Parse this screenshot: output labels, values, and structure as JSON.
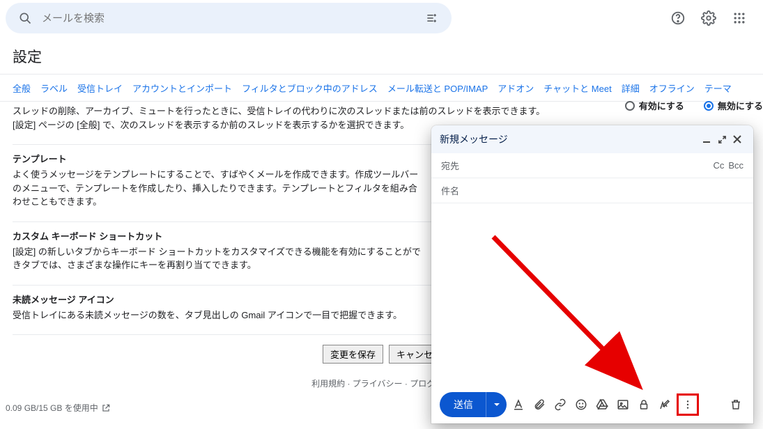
{
  "search": {
    "placeholder": "メールを検索"
  },
  "settings_title": "設定",
  "tabs": [
    "全般",
    "ラベル",
    "受信トレイ",
    "アカウントとインポート",
    "フィルタとブロック中のアドレス",
    "メール転送と POP/IMAP",
    "アドオン",
    "チャットと Meet",
    "詳細",
    "オフライン",
    "テーマ"
  ],
  "active_tab_index": 8,
  "radio": {
    "enable": "有効にする",
    "disable": "無効にする",
    "selected": "disable"
  },
  "sections": {
    "autoadvance_desc": "スレッドの削除、アーカイブ、ミュートを行ったときに、受信トレイの代わりに次のスレッドまたは前のスレッドを表示できます。[設定] ページの [全般] で、次のスレッドを表示するか前のスレッドを表示するかを選択できます。",
    "templates_title": "テンプレート",
    "templates_desc": "よく使うメッセージをテンプレートにすることで、すばやくメールを作成できます。作成ツールバーのメニューで、テンプレートを作成したり、挿入したりできます。テンプレートとフィルタを組み合わせこともできます。",
    "shortcuts_title": "カスタム キーボード ショートカット",
    "shortcuts_desc": "[設定] の新しいタブからキーボード ショートカットをカスタマイズできる機能を有効にすることができタブでは、さまざまな操作にキーを再割り当てできます。",
    "unread_title": "未読メッセージ アイコン",
    "unread_desc": "受信トレイにある未読メッセージの数を、タブ見出しの Gmail アイコンで一目で把握できます。"
  },
  "buttons": {
    "save": "変更を保存",
    "cancel": "キャンセ"
  },
  "footer": {
    "terms": "利用規約",
    "privacy": "プライバシー",
    "program": "プログラム"
  },
  "storage": "0.09 GB/15 GB を使用中",
  "compose": {
    "title": "新規メッセージ",
    "to_label": "宛先",
    "cc": "Cc",
    "bcc": "Bcc",
    "subject_label": "件名",
    "send": "送信"
  }
}
